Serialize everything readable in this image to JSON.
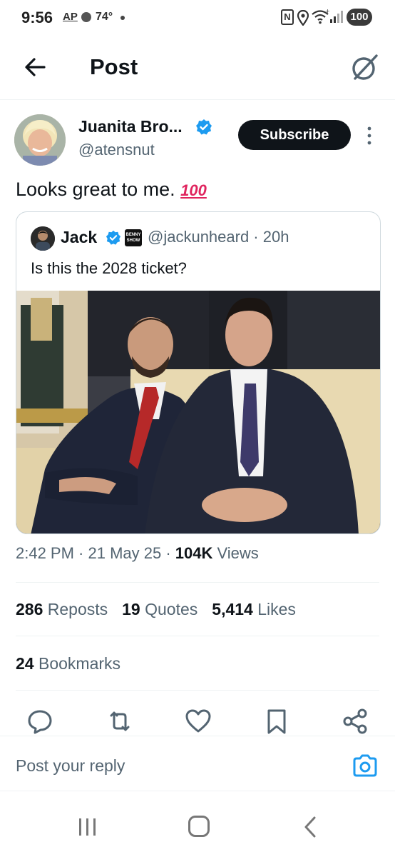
{
  "status_bar": {
    "time": "9:56",
    "ap": "AP",
    "temperature": "74°",
    "nfc": "N",
    "battery": "100"
  },
  "header": {
    "title": "Post",
    "back_icon": "arrow-left-icon",
    "grok_icon": "grok-icon"
  },
  "post": {
    "author_name": "Juanita Bro...",
    "author_handle": "@atensnut",
    "subscribe_label": "Subscribe",
    "text": "Looks great to me.",
    "emoji": "100",
    "quoted": {
      "name": "Jack",
      "handle_time": "@jackunheard · 20h",
      "affiliate_badge": "BENNY SHOW",
      "text": "Is this the 2028 ticket?"
    },
    "time": "2:42 PM",
    "date": "21 May 25",
    "views_count": "104K",
    "views_label": "Views",
    "reposts_count": "286",
    "reposts_label": "Reposts",
    "quotes_count": "19",
    "quotes_label": "Quotes",
    "likes_count": "5,414",
    "likes_label": "Likes",
    "bookmarks_count": "24",
    "bookmarks_label": "Bookmarks"
  },
  "actions": [
    "reply-icon",
    "repost-icon",
    "like-icon",
    "bookmark-icon",
    "share-icon"
  ],
  "reply": {
    "placeholder": "Post your reply"
  },
  "colors": {
    "accent": "#1d9bf0",
    "text": "#0f1419",
    "muted": "#536471",
    "border": "#eff3f4"
  }
}
